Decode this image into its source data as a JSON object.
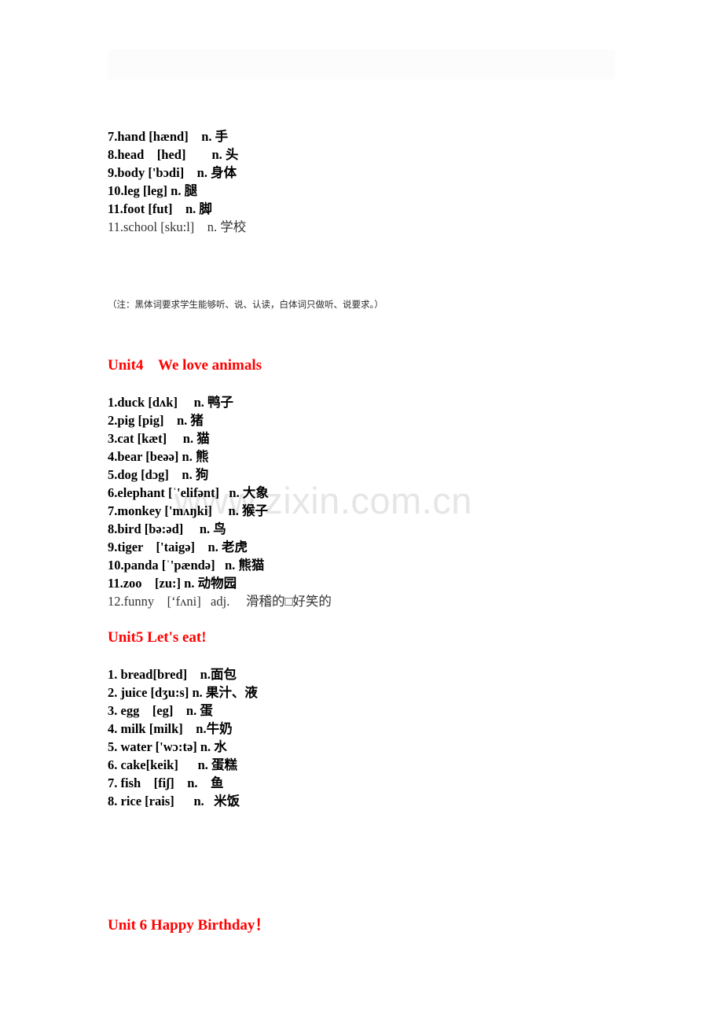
{
  "document": {
    "watermark": "www.zixin.com.cn",
    "header_band_color": "#fcfcfd",
    "heading_color": "#ff0000"
  },
  "section_body_parts": {
    "entries": [
      "7.hand [hænd]    n. 手",
      "8.head    [hed]        n. 头",
      "9.body ['bɔdi]    n. 身体",
      "10.leg [leg] n. 腿",
      "11.foot [fut]    n. 脚"
    ],
    "plain_entries": [
      "11.school [sku:l]    n. 学校"
    ]
  },
  "note": "（注：黑体词要求学生能够听、说、认读，白体词只做听、说要求。）",
  "unit4": {
    "heading": "Unit4    We love animals",
    "entries": [
      "1.duck [dʌk]     n. 鸭子",
      "2.pig [pig]    n. 猪",
      "3.cat [kæt]     n. 猫",
      "4.bear [beəə] n. 熊",
      "5.dog [dɔg]    n. 狗",
      "6.elephant [ˈ'elifənt]   n. 大象",
      "7.monkey ['mʌŋki]     n. 猴子",
      "8.bird [bə:əd]     n. 鸟",
      "9.tiger    ['taigə]    n. 老虎",
      "10.panda [ˈ'pændə]   n. 熊猫",
      "11.zoo    [zu:] n. 动物园"
    ],
    "plain_entries": [
      "12.funny    [‘fʌni]   adj.     滑稽的□好笑的"
    ]
  },
  "unit5": {
    "heading": "Unit5 Let's eat!",
    "entries": [
      "1. bread[bred]    n.面包",
      "2. juice [dʒu:s] n. 果汁、液",
      "3. egg    [eg]    n. 蛋",
      "4. milk [milk]    n.牛奶",
      "5. water ['wɔ:tə] n. 水",
      "6. cake[keik]      n. 蛋糕",
      "7. fish    [fiʃ]    n.    鱼",
      "8. rice [rais]      n.   米饭"
    ]
  },
  "unit6": {
    "heading": "Unit 6 Happy Birthday！"
  }
}
